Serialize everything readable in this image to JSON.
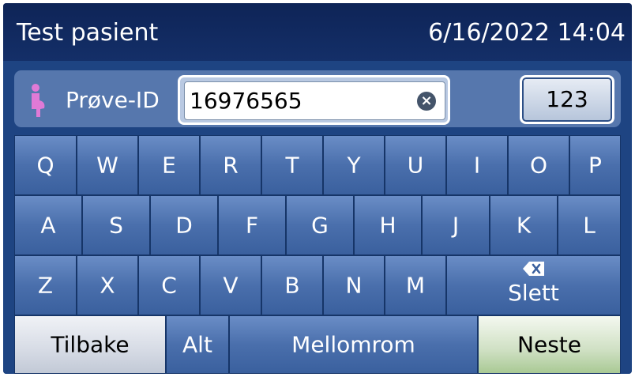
{
  "header": {
    "title": "Test pasient",
    "datetime": "6/16/2022 14:04"
  },
  "sample": {
    "icon": "pregnant-woman-icon",
    "label": "Prøve-ID",
    "value": "16976565",
    "clear_icon": "clear-icon",
    "numeric_button": "123"
  },
  "keyboard": {
    "row1": [
      "Q",
      "W",
      "E",
      "R",
      "T",
      "Y",
      "U",
      "I",
      "O",
      "P"
    ],
    "row2": [
      "A",
      "S",
      "D",
      "F",
      "G",
      "H",
      "J",
      "K",
      "L"
    ],
    "row3": [
      "Z",
      "X",
      "C",
      "V",
      "B",
      "N",
      "M"
    ],
    "delete_label": "Slett",
    "delete_icon": "backspace-icon",
    "back_label": "Tilbake",
    "alt_label": "Alt",
    "space_label": "Mellomrom",
    "next_label": "Neste"
  },
  "colors": {
    "header_bg": "#0e2457",
    "key_blue": "#4a6fac",
    "next_green": "#a9c994",
    "icon_pink": "#e07ad6"
  }
}
